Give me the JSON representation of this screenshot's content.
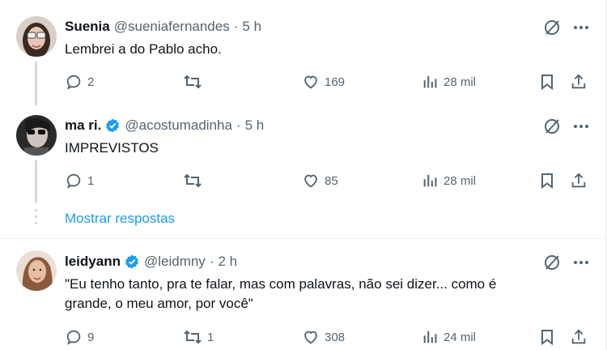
{
  "tweets": [
    {
      "name": "Suenia",
      "handle": "@sueniafernandes",
      "time": "5 h",
      "verified": false,
      "text_lines": [
        "Lembrei a do Pablo acho."
      ],
      "replies": "2",
      "retweets": "",
      "likes": "169",
      "views": "28 mil"
    },
    {
      "name": "ma ri.",
      "handle": "@acostumadinha",
      "time": "5 h",
      "verified": true,
      "text_lines": [
        "IMPREVISTOS"
      ],
      "replies": "1",
      "retweets": "",
      "likes": "85",
      "views": "28 mil"
    },
    {
      "name": "leidyann",
      "handle": "@leidmny",
      "time": "2 h",
      "verified": true,
      "text_lines": [
        "\"Eu tenho tanto, pra te falar, mas com palavras, não sei dizer... como é",
        "grande, o meu amor, por você\""
      ],
      "replies": "9",
      "retweets": "1",
      "likes": "308",
      "views": "24 mil"
    }
  ],
  "show_replies_label": "Mostrar respostas",
  "separator": "·",
  "icons": [
    "reply-icon",
    "retweet-icon",
    "like-icon",
    "views-icon",
    "bookmark-icon",
    "share-icon",
    "grok-icon",
    "more-icon",
    "verified-badge-icon"
  ],
  "colors": {
    "accent": "#1d9bf0",
    "muted": "#536471",
    "text": "#0f1419",
    "border": "#eff3f4",
    "thread": "#cfd9de"
  }
}
